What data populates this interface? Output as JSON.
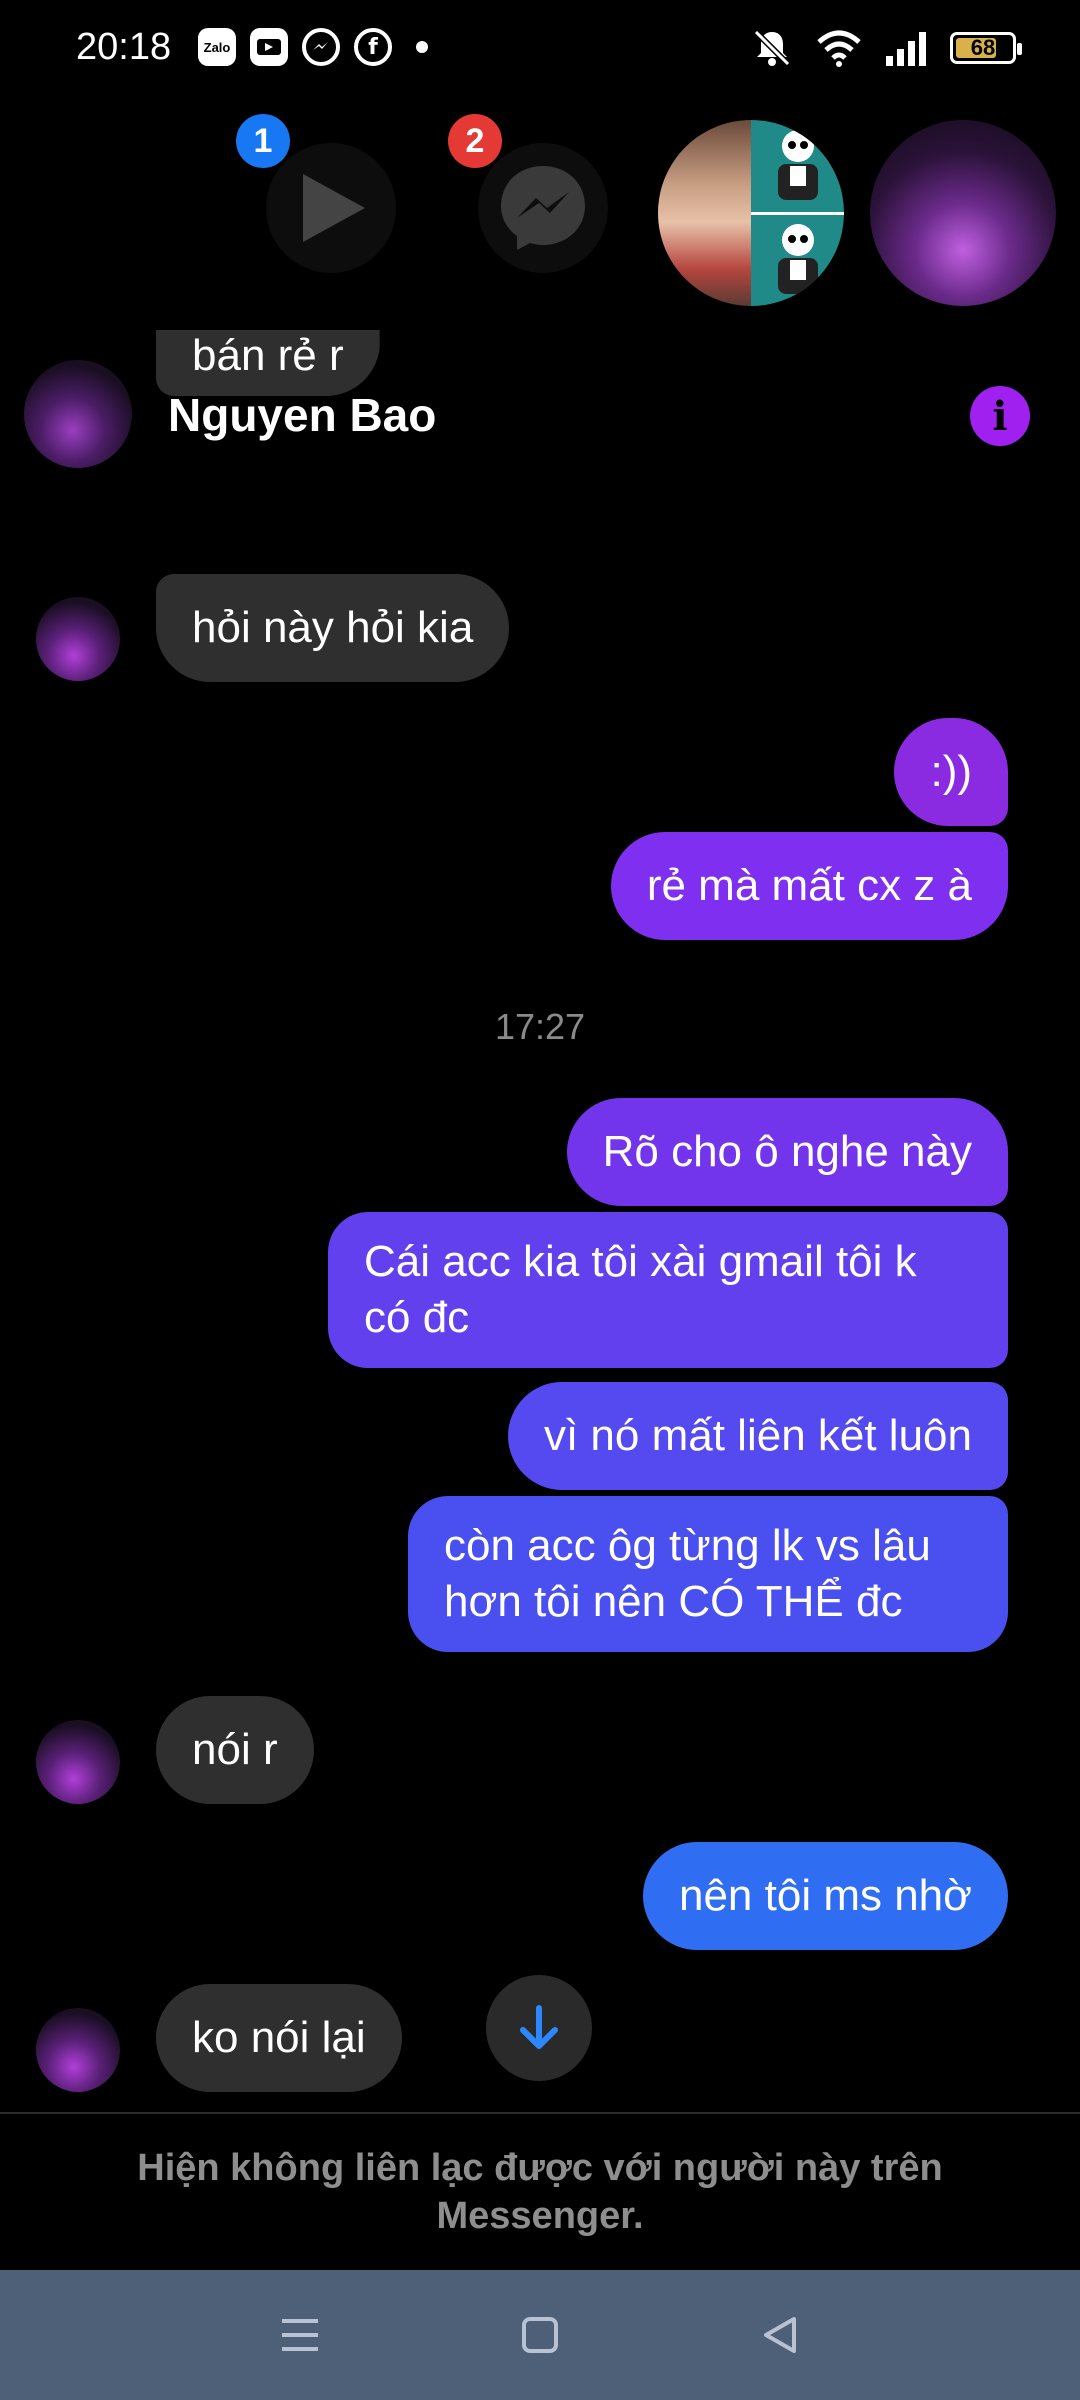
{
  "status_bar": {
    "time": "20:18",
    "app_icons": [
      "Zalo",
      "zing-mp3-icon",
      "messenger-icon",
      "facebook-icon"
    ],
    "zalo_label": "Zalo",
    "battery": "68"
  },
  "tray": {
    "video_badge": "1",
    "messenger_badge": "2"
  },
  "chat": {
    "contact_name": "Nguyen Bao",
    "messages": [
      {
        "from": "them",
        "text": "bán rẻ r"
      },
      {
        "from": "them",
        "text": "hỏi này hỏi kia"
      },
      {
        "from": "me",
        "text": ":))"
      },
      {
        "from": "me",
        "text": "rẻ mà mất cx z à"
      },
      {
        "from": "me",
        "text": "Rõ cho ô nghe này"
      },
      {
        "from": "me",
        "text": "Cái acc kia tôi xài gmail tôi k có đc"
      },
      {
        "from": "me",
        "text": "vì nó mất liên kết luôn"
      },
      {
        "from": "me",
        "text": "còn acc ôg từng lk vs lâu hơn tôi nên CÓ THỂ đc"
      },
      {
        "from": "them",
        "text": "nói r"
      },
      {
        "from": "me",
        "text": "nên tôi ms nhờ"
      },
      {
        "from": "them",
        "text": "ko nói lại"
      }
    ],
    "timestamp": "17:27",
    "notice": "Hiện không liên lạc được với người này trên Messenger."
  },
  "colors": {
    "bubble_incoming": "#2f2f2f",
    "bubble_out_top": "#8a2be2",
    "bubble_out_mid": "#6a3bea",
    "bubble_out_low": "#4f4ff0",
    "bubble_out_bottom": "#2f6ef2",
    "accent": "#a020f0",
    "navbar": "#4e5f78"
  }
}
